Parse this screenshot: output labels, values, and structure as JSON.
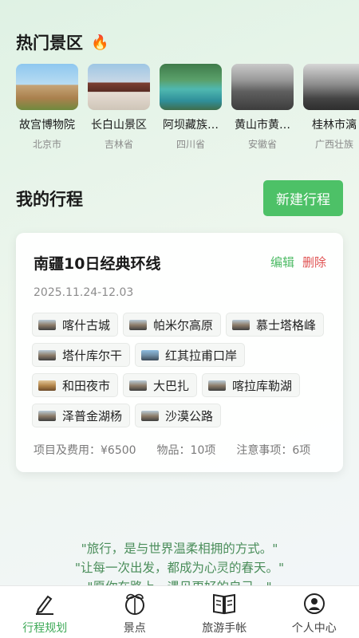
{
  "hot": {
    "title": "热门景区",
    "spots": [
      {
        "name": "故宫博物院",
        "province": "北京市"
      },
      {
        "name": "长白山景区",
        "province": "吉林省"
      },
      {
        "name": "阿坝藏族…",
        "province": "四川省"
      },
      {
        "name": "黄山市黄…",
        "province": "安徽省"
      },
      {
        "name": "桂林市漓",
        "province": "广西壮族"
      }
    ]
  },
  "trips": {
    "title": "我的行程",
    "new_label": "新建行程",
    "card": {
      "title": "南疆10日经典环线",
      "edit_label": "编辑",
      "delete_label": "删除",
      "dates": "2025.11.24-12.03",
      "tags": [
        "喀什古城",
        "帕米尔高原",
        "慕士塔格峰",
        "塔什库尔干",
        "红其拉甫口岸",
        "和田夜市",
        "大巴扎",
        "喀拉库勒湖",
        "泽普金湖杨",
        "沙漠公路"
      ],
      "cost": "项目及费用：¥6500",
      "items": "物品：10项",
      "notes": "注意事项：6项"
    }
  },
  "quotes": [
    "\"旅行，是与世界温柔相拥的方式。\"",
    "\"让每一次出发，都成为心灵的春天。\"",
    "\"愿你在路上，遇见更好的自己。\""
  ],
  "nav": {
    "items": [
      {
        "label": "行程规划",
        "icon": "pen-icon"
      },
      {
        "label": "景点",
        "icon": "leaf-globe-icon"
      },
      {
        "label": "旅游手帐",
        "icon": "book-icon"
      },
      {
        "label": "个人中心",
        "icon": "user-icon"
      }
    ],
    "active_color": "#3eaa58"
  },
  "colors": {
    "accent": "#4dc167",
    "delete": "#e05252"
  }
}
